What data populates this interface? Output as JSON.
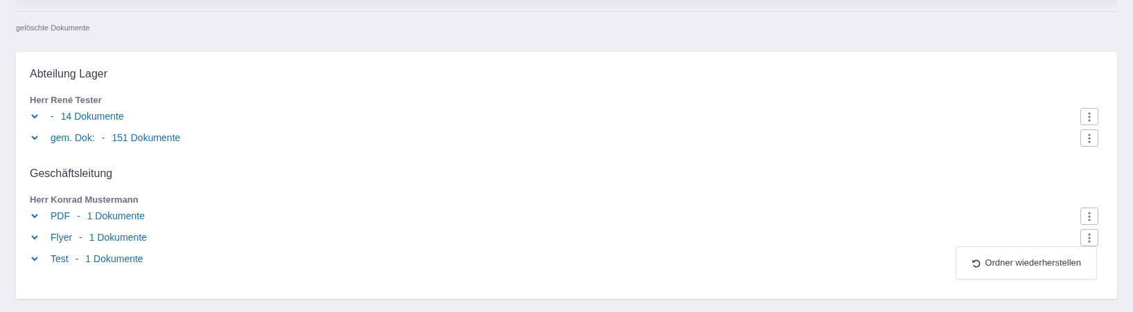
{
  "breadcrumb": "gelöschte Dokumente",
  "sections": [
    {
      "title": "Abteilung Lager",
      "person": "Herr René Tester",
      "folders": [
        {
          "separator": "-",
          "count": "14 Dokumente",
          "menu_button": true
        },
        {
          "name": "gem. Dok:",
          "separator": "-",
          "count": "151 Dokumente",
          "menu_button": true
        }
      ]
    },
    {
      "title": "Geschäftsleitung",
      "person": "Herr Konrad Mustermann",
      "folders": [
        {
          "name": "PDF",
          "separator": "-",
          "count": "1 Dokumente",
          "menu_button": true
        },
        {
          "name": "Flyer",
          "separator": "-",
          "count": "1 Dokumente",
          "menu_button": true
        },
        {
          "name": "Test",
          "separator": "-",
          "count": "1 Dokumente",
          "menu_button": false
        }
      ]
    }
  ],
  "menu": {
    "items": [
      {
        "label": "Ordner wiederherstellen"
      }
    ]
  }
}
